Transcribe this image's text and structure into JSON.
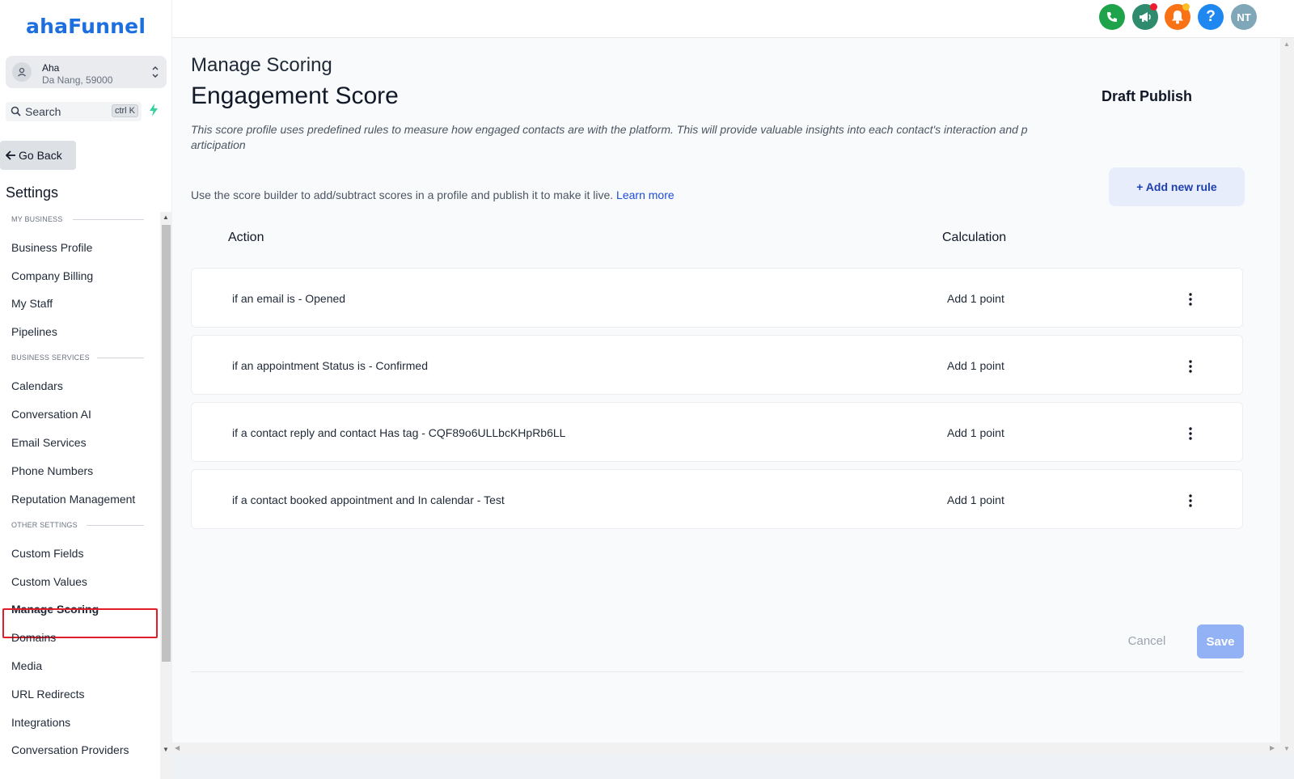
{
  "brand": {
    "logo_text": "ahaFunnel",
    "logo_color": "#1d6fe0"
  },
  "location": {
    "name": "Aha",
    "address": "Da Nang, 59000"
  },
  "search": {
    "label": "Search",
    "shortcut": "ctrl K"
  },
  "sidebar": {
    "go_back": "Go Back",
    "settings_title": "Settings",
    "sections": [
      {
        "label": "MY BUSINESS",
        "items": [
          "Business Profile",
          "Company Billing",
          "My Staff",
          "Pipelines"
        ]
      },
      {
        "label": "BUSINESS SERVICES",
        "items": [
          "Calendars",
          "Conversation AI",
          "Email Services",
          "Phone Numbers",
          "Reputation Management"
        ]
      },
      {
        "label": "OTHER SETTINGS",
        "items": [
          "Custom Fields",
          "Custom Values",
          "Manage Scoring",
          "Domains",
          "Media",
          "URL Redirects",
          "Integrations",
          "Conversation Providers"
        ]
      }
    ],
    "active_item": "Manage Scoring"
  },
  "topbar": {
    "buttons": [
      {
        "name": "phone-icon",
        "color": "#1fa34a"
      },
      {
        "name": "megaphone-icon",
        "color": "#2e8b6e",
        "badge_color": "#ef1c2d"
      },
      {
        "name": "bell-icon",
        "color": "#f97316",
        "badge_color": "#fbbf24"
      },
      {
        "name": "help-icon",
        "color": "#1e88f0"
      }
    ],
    "user_initials": "NT",
    "user_color": "#7fa7b8"
  },
  "page": {
    "breadcrumb": "Manage Scoring",
    "title": "Engagement Score",
    "status": "Draft Publish",
    "description": "This score profile uses predefined rules to measure how engaged contacts are with the platform. This will provide valuable insights into each contact's interaction and p articipation",
    "helper_text": "Use the score builder to add/subtract scores in a profile and publish it to make it live.",
    "learn_more": "Learn more",
    "add_rule": "+ Add new rule"
  },
  "table": {
    "columns": {
      "action": "Action",
      "calculation": "Calculation"
    },
    "rows": [
      {
        "action": "if an email is - Opened",
        "calculation": "Add 1 point"
      },
      {
        "action": "if an appointment Status is - Confirmed",
        "calculation": "Add 1 point"
      },
      {
        "action": "if a contact reply and contact Has tag - CQF89o6ULLbcKHpRb6LL",
        "calculation": "Add 1 point"
      },
      {
        "action": "if a contact booked appointment and In calendar - Test",
        "calculation": "Add 1 point"
      }
    ]
  },
  "footer": {
    "cancel": "Cancel",
    "save": "Save"
  }
}
